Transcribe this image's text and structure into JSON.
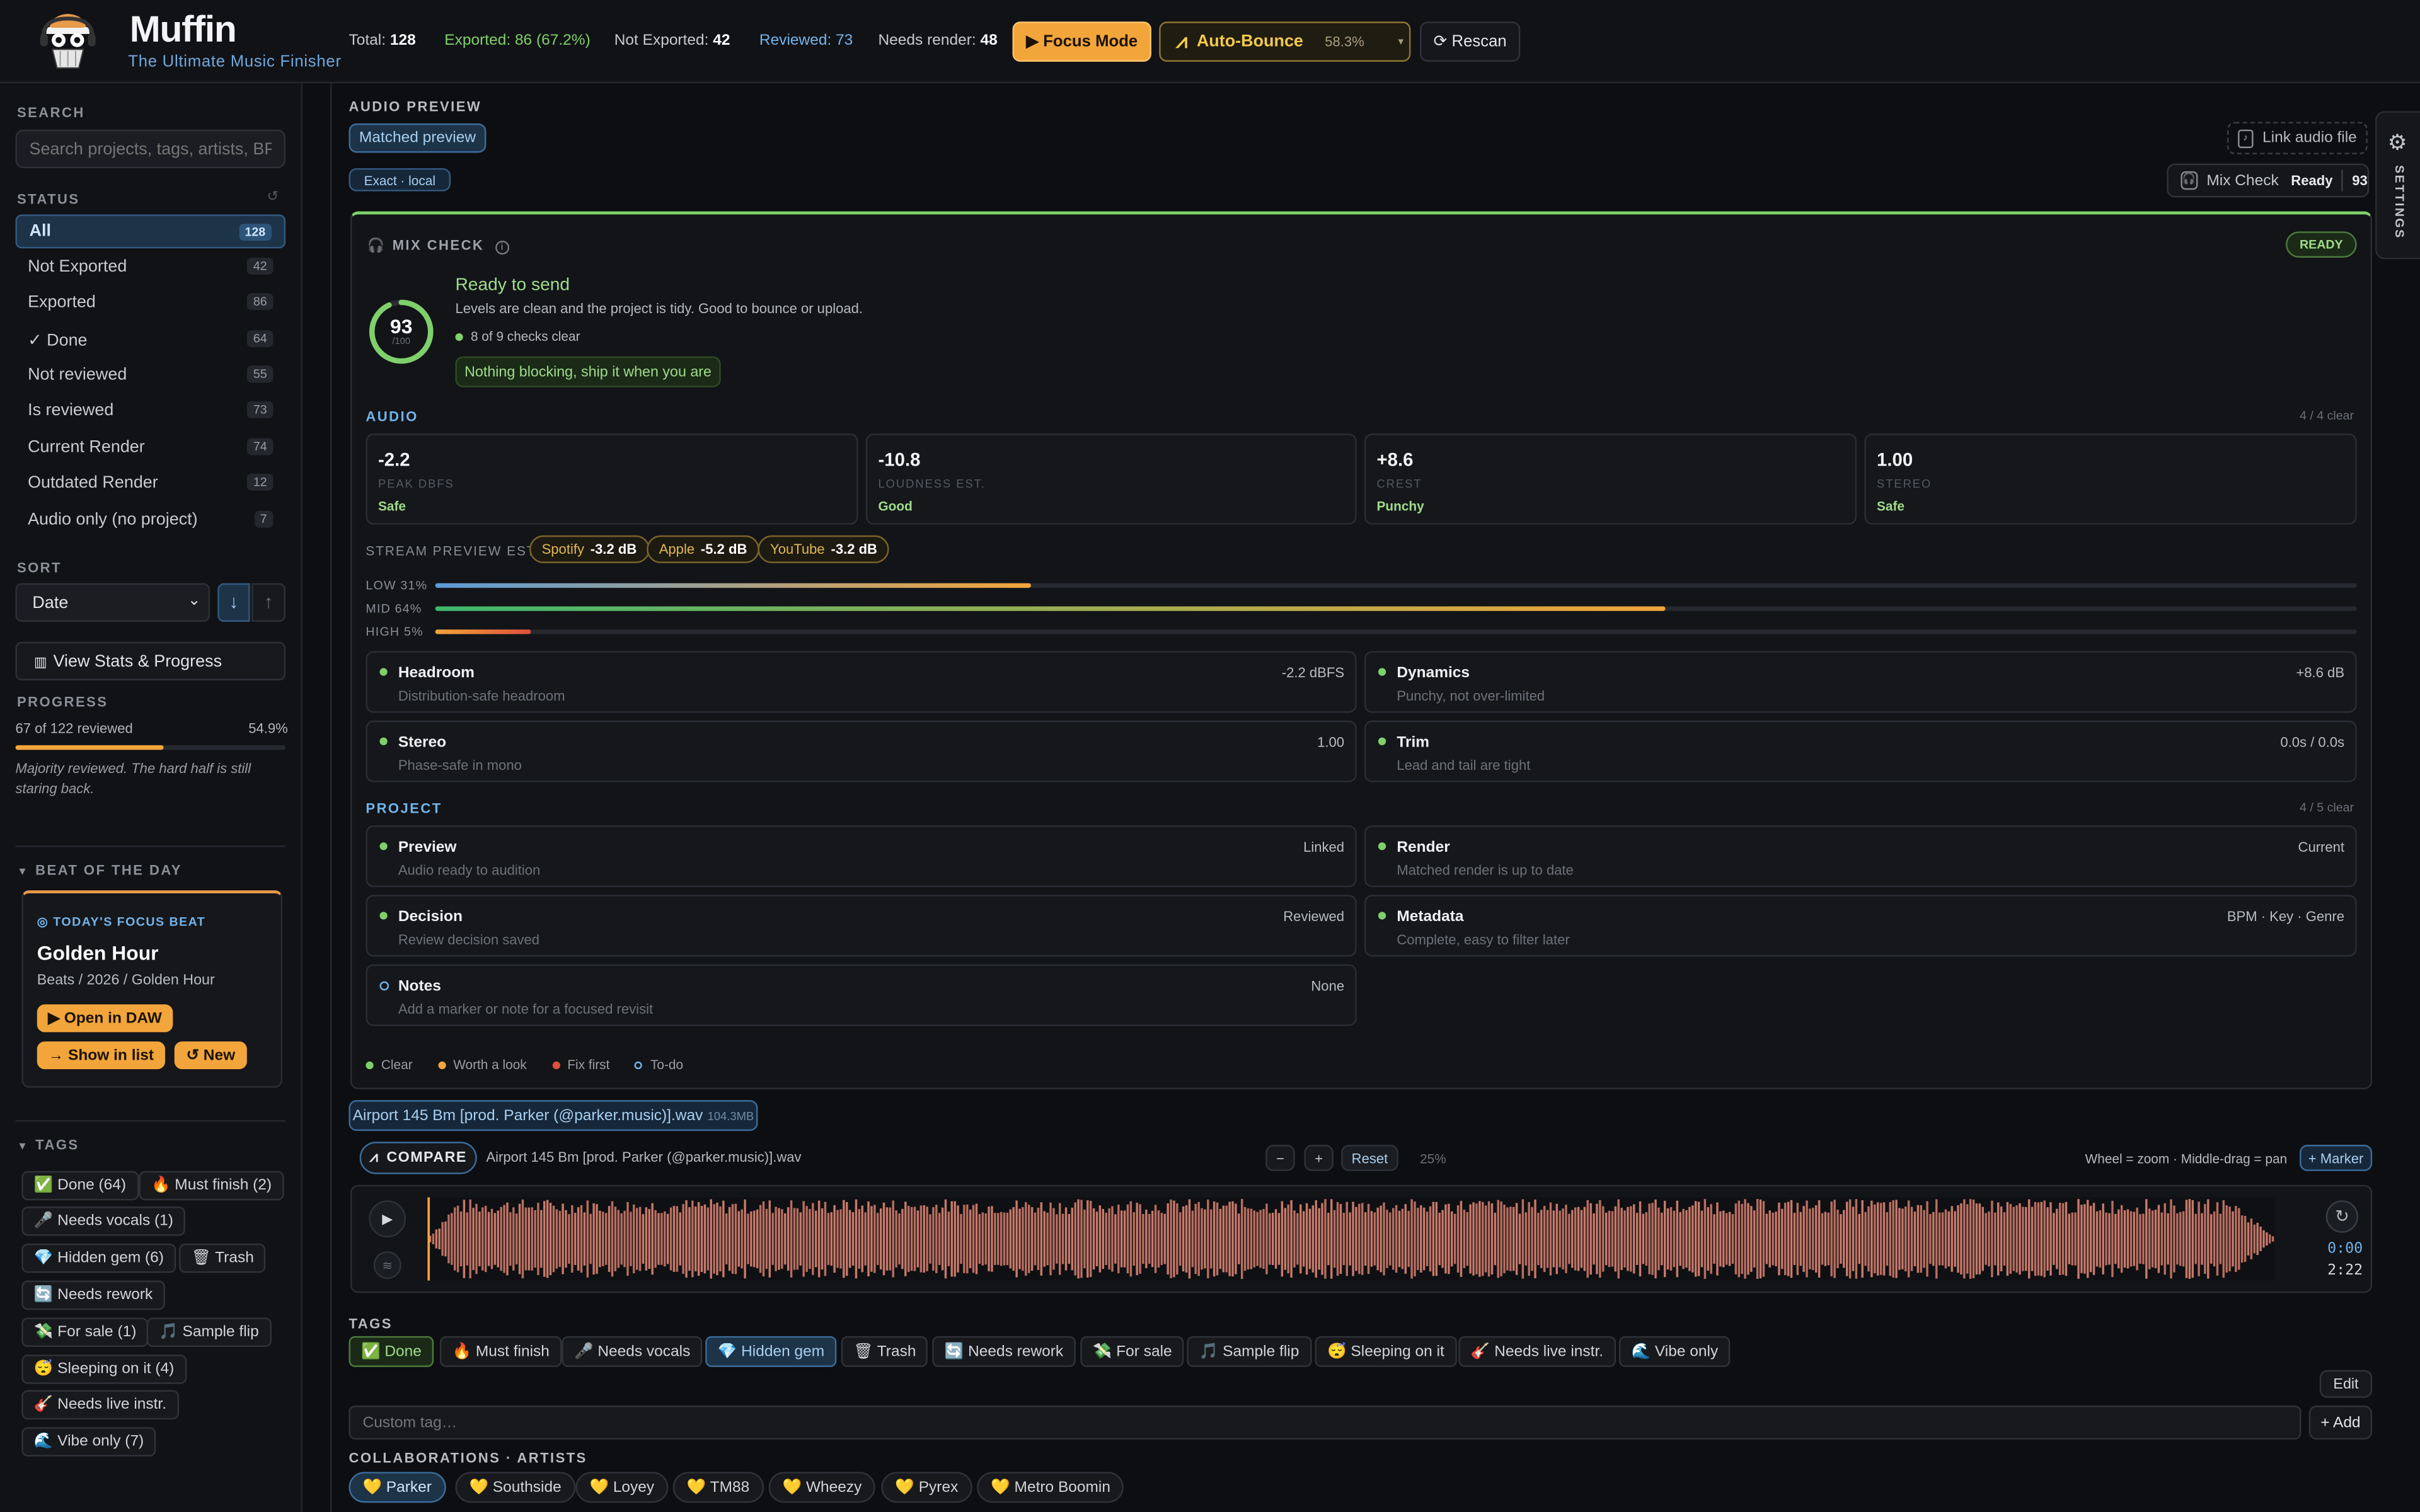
{
  "app": {
    "title": "Muffin",
    "subtitle": "The Ultimate Music Finisher"
  },
  "stats": {
    "total_label": "Total:",
    "total": "128",
    "exported": "Exported: 86 (67.2%)",
    "not_exported_label": "Not Exported:",
    "not_exported": "42",
    "reviewed": "Reviewed: 73",
    "needs_render_label": "Needs render:",
    "needs_render": "48"
  },
  "toolbar": {
    "focus_mode": "▶ Focus Mode",
    "auto_bounce": "Auto-Bounce",
    "auto_bounce_pct": "58.3%",
    "rescan": "Rescan"
  },
  "sidebar": {
    "search_label": "SEARCH",
    "search_placeholder": "Search projects, tags, artists, BPM…",
    "status_label": "STATUS",
    "status_items": [
      {
        "label": "All",
        "count": "128"
      },
      {
        "label": "Not Exported",
        "count": "42"
      },
      {
        "label": "Exported",
        "count": "86"
      },
      {
        "label": "✓ Done",
        "count": "64"
      },
      {
        "label": "Not reviewed",
        "count": "55"
      },
      {
        "label": "Is reviewed",
        "count": "73"
      },
      {
        "label": "Current Render",
        "count": "74"
      },
      {
        "label": "Outdated Render",
        "count": "12"
      },
      {
        "label": "Audio only (no project)",
        "count": "7"
      }
    ],
    "sort_label": "SORT",
    "sort_value": "Date",
    "stats_button": "View Stats & Progress",
    "progress_label": "PROGRESS",
    "progress_text": "67 of 122 reviewed",
    "progress_pct": "54.9%",
    "progress_value": 54.9,
    "progress_note": "Majority reviewed. The hard half is still staring back.",
    "beat_label": "BEAT OF THE DAY",
    "beat": {
      "kicker": "TODAY'S FOCUS BEAT",
      "title": "Golden Hour",
      "path": "Beats / 2026 / Golden Hour",
      "open": "▶ Open in DAW",
      "show": "→ Show in list",
      "new": "↺ New"
    },
    "tags_label": "TAGS",
    "tags": [
      "✅ Done (64)",
      "🔥 Must finish (2)",
      "🎤 Needs vocals (1)",
      "💎 Hidden gem (6)",
      "🗑 Trash",
      "🔄 Needs rework",
      "💸 For sale (1)",
      "🎵 Sample flip",
      "😴 Sleeping on it (4)",
      "🎸 Needs live instr.",
      "🌊 Vibe only (7)"
    ]
  },
  "preview": {
    "section_label": "AUDIO PREVIEW",
    "matched": "Matched preview",
    "exact": "Exact · local",
    "link_audio": "Link audio file",
    "mixcheck_badge": {
      "label": "Mix Check",
      "status": "Ready",
      "score": "93"
    }
  },
  "mixcheck": {
    "title": "MIX CHECK",
    "status": "READY",
    "score": "93",
    "score_max": "/100",
    "score_value": 93,
    "headline": "Ready to send",
    "desc": "Levels are clean and the project is tidy. Good to bounce or upload.",
    "checks": "8 of 9 checks clear",
    "note": "Nothing blocking, ship it when you are",
    "audio_label": "AUDIO",
    "audio_clear": "4 / 4 clear",
    "metrics": [
      {
        "value": "-2.2",
        "label": "PEAK DBFS",
        "status": "Safe"
      },
      {
        "value": "-10.8",
        "label": "LOUDNESS EST.",
        "status": "Good"
      },
      {
        "value": "+8.6",
        "label": "CREST",
        "status": "Punchy"
      },
      {
        "value": "1.00",
        "label": "STEREO",
        "status": "Safe"
      }
    ],
    "stream_label": "STREAM PREVIEW EST.",
    "streams": [
      {
        "name": "Spotify",
        "value": "-3.2 dB"
      },
      {
        "name": "Apple",
        "value": "-5.2 dB"
      },
      {
        "name": "YouTube",
        "value": "-3.2 dB"
      }
    ],
    "bands": [
      {
        "label": "LOW 31%",
        "value": 31
      },
      {
        "label": "MID 64%",
        "value": 64
      },
      {
        "label": "HIGH 5%",
        "value": 5
      }
    ],
    "audio_checks": [
      {
        "title": "Headroom",
        "desc": "Distribution-safe headroom",
        "value": "-2.2 dBFS"
      },
      {
        "title": "Dynamics",
        "desc": "Punchy, not over-limited",
        "value": "+8.6 dB"
      },
      {
        "title": "Stereo",
        "desc": "Phase-safe in mono",
        "value": "1.00"
      },
      {
        "title": "Trim",
        "desc": "Lead and tail are tight",
        "value": "0.0s / 0.0s"
      }
    ],
    "project_label": "PROJECT",
    "project_clear": "4 / 5 clear",
    "project_checks": [
      {
        "title": "Preview",
        "desc": "Audio ready to audition",
        "value": "Linked"
      },
      {
        "title": "Render",
        "desc": "Matched render is up to date",
        "value": "Current"
      },
      {
        "title": "Decision",
        "desc": "Review decision saved",
        "value": "Reviewed"
      },
      {
        "title": "Metadata",
        "desc": "Complete, easy to filter later",
        "value": "BPM · Key · Genre"
      },
      {
        "title": "Notes",
        "desc": "Add a marker or note for a focused revisit",
        "value": "None"
      }
    ],
    "legend": [
      "Clear",
      "Worth a look",
      "Fix first",
      "To-do"
    ]
  },
  "file": {
    "name": "Airport 145 Bm [prod. Parker (@parker.music)].wav",
    "size": "104.3MB"
  },
  "compare": {
    "label": "COMPARE",
    "file": "Airport 145 Bm [prod. Parker (@parker.music)].wav",
    "minus": "−",
    "plus": "+",
    "reset": "Reset",
    "zoom": "25%",
    "hint": "Wheel = zoom · Middle-drag = pan",
    "marker": "+ Marker"
  },
  "player": {
    "time_current": "0:00",
    "time_total": "2:22"
  },
  "tags_section": {
    "label": "TAGS",
    "tags": [
      "✅ Done",
      "🔥 Must finish",
      "🎤 Needs vocals",
      "💎 Hidden gem",
      "🗑 Trash",
      "🔄 Needs rework",
      "💸 For sale",
      "🎵 Sample flip",
      "😴 Sleeping on it",
      "🎸 Needs live instr.",
      "🌊 Vibe only"
    ],
    "edit": "Edit",
    "custom_placeholder": "Custom tag…",
    "add": "+ Add"
  },
  "collab": {
    "label": "COLLABORATIONS · ARTISTS",
    "artists": [
      "💛 Parker",
      "💛 Southside",
      "💛 Loyey",
      "💛 TM88",
      "💛 Wheezy",
      "💛 Pyrex",
      "💛 Metro Boomin"
    ]
  },
  "settings_label": "SETTINGS",
  "colors": {
    "accent": "#f2a53a",
    "blue": "#72b3ea",
    "green": "#7fd06b",
    "bg": "#0d0e11"
  }
}
